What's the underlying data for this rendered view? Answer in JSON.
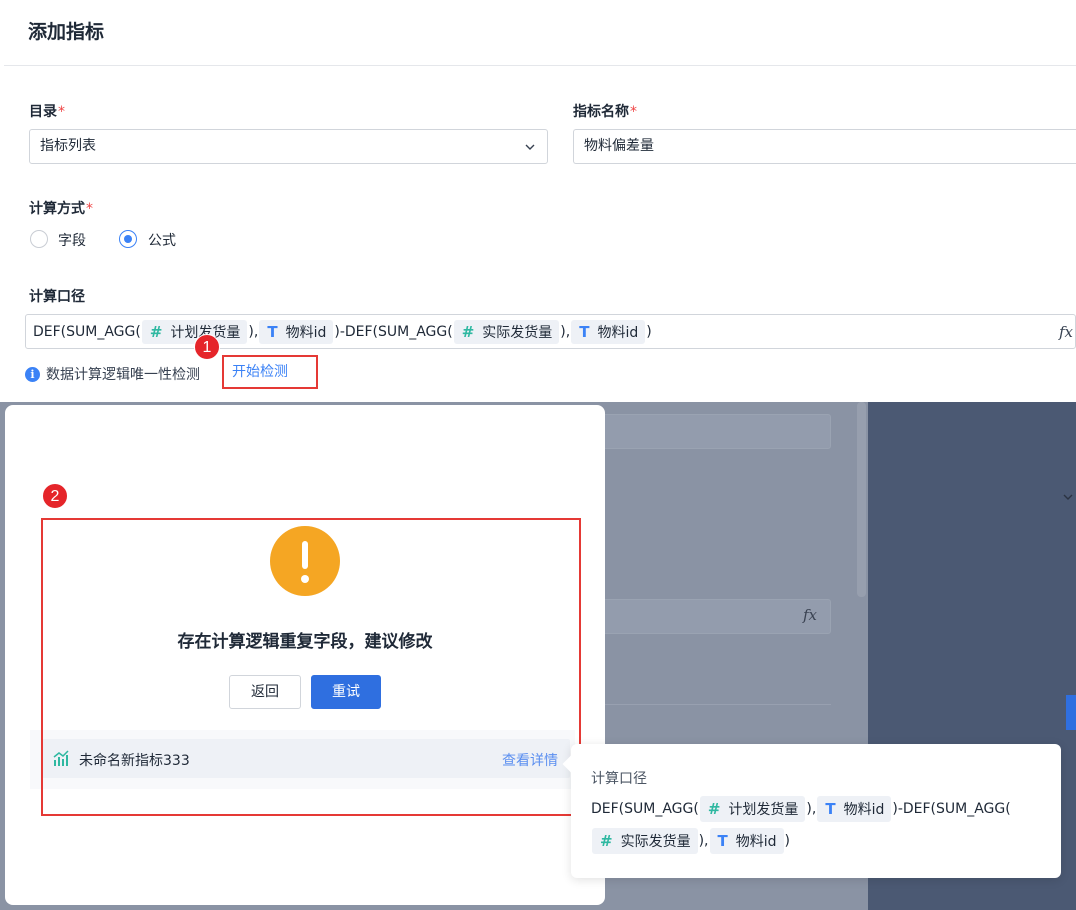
{
  "dialog": {
    "title": "添加指标",
    "catalog": {
      "label": "目录",
      "required": "*",
      "value": "指标列表"
    },
    "metric_name": {
      "label": "指标名称",
      "required": "*",
      "value": "物料偏差量"
    },
    "calc_method": {
      "label": "计算方式",
      "required": "*",
      "options": [
        "字段",
        "公式"
      ],
      "selected": "公式"
    },
    "calc_formula": {
      "label": "计算口径",
      "parts": {
        "p1": "DEF(SUM_AGG(",
        "t1": "计划发货量",
        "p2": "),",
        "t2": "物料id",
        "p3": ")-DEF(SUM_AGG(",
        "t3": "实际发货量",
        "p4": "),",
        "t4": "物料id",
        "p5": ")"
      },
      "fx_icon": "fx-icon"
    },
    "uniqueness_check": {
      "text": "数据计算逻辑唯一性检测",
      "action": "开始检测"
    },
    "badges": [
      "1",
      "2"
    ]
  },
  "modal": {
    "icon": "warning-icon",
    "message": "存在计算逻辑重复字段，建议修改",
    "back_label": "返回",
    "retry_label": "重试",
    "items": [
      {
        "name": "未命名新指标333",
        "action": "查看详情",
        "icon": "metric-chart-icon"
      }
    ]
  },
  "popover": {
    "title": "计算口径",
    "parts": {
      "p1": "DEF(SUM_AGG(",
      "t1": "计划发货量",
      "p2": "),",
      "t2": "物料id",
      "p3": ")-DEF(SUM_AGG(",
      "t3": "实际发货量",
      "p4": "),",
      "t4": "物料id",
      "p5": ")"
    }
  },
  "colors": {
    "accent": "#2f6fe0",
    "warning": "#f5a623",
    "annotation": "#e53935",
    "number_field": "#2fb8a1"
  }
}
